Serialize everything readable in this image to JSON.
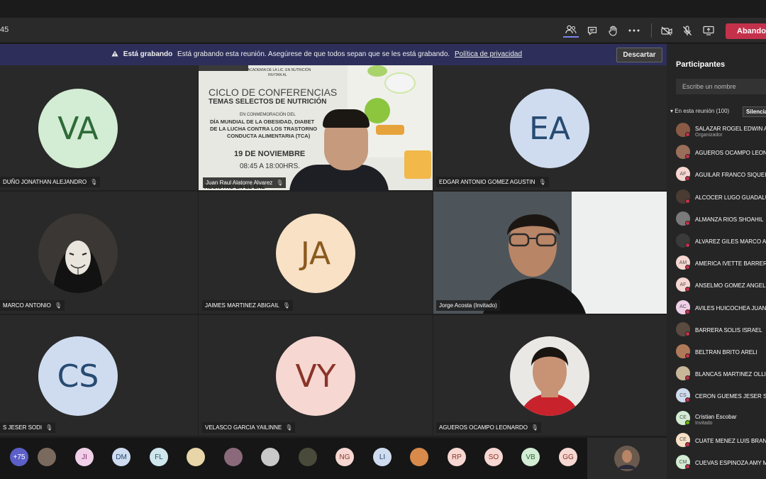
{
  "meeting": {
    "timer": "45"
  },
  "toolbar": {
    "participants_icon": "people-icon",
    "chat_icon": "chat-icon",
    "hand_icon": "raise-hand-icon",
    "more_icon": "more-icon",
    "camera_icon": "camera-off-icon",
    "mic_icon": "mic-off-icon",
    "share_icon": "share-screen-icon",
    "leave_label": "Abandonar"
  },
  "banner": {
    "bold": "Está grabando",
    "text": "Está grabando esta reunión. Asegúrese de que todos sepan que se les está grabando.",
    "link": "Política de privacidad",
    "dismiss_label": "Descartar"
  },
  "tiles": [
    {
      "name": "DUÑO JONATHAN ALEJANDRO",
      "initials": "VA",
      "bg": "#d3ecd4",
      "fg": "#2e6b37"
    },
    {
      "name": "Juan Raul Alatorre Alvarez",
      "initials": "",
      "bg": "",
      "fg": ""
    },
    {
      "name": "EDGAR ANTONIO GOMEZ AGUSTIN",
      "initials": "EA",
      "bg": "#cfdcef",
      "fg": "#274a72"
    },
    {
      "name": "MARCO ANTONIO",
      "initials": "",
      "bg": "",
      "fg": ""
    },
    {
      "name": "JAIMES MARTINEZ ABIGAIL",
      "initials": "JA",
      "bg": "#f8e1c5",
      "fg": "#8a5a1e"
    },
    {
      "name": "Jorge Acosta (Invitado)",
      "initials": "",
      "bg": "",
      "fg": ""
    },
    {
      "name": "S JESER SODI",
      "initials": "CS",
      "bg": "#cfdcef",
      "fg": "#274a72"
    },
    {
      "name": "VELASCO GARCIA YAILINNE",
      "initials": "VY",
      "bg": "#f6d7d2",
      "fg": "#8a3428"
    },
    {
      "name": "AGUEROS OCAMPO LEONARDO",
      "initials": "",
      "bg": "",
      "fg": ""
    }
  ],
  "slide": {
    "line1": "LA ACADEMIA DE LA LIC. EN NUTRICIÓN",
    "line1b": "INVITAN AL",
    "title1": "CICLO DE CONFERENCIAS",
    "title2": "TEMAS SELECTOS DE NUTRICIÓN",
    "sub1": "EN CONMEMORACIÓN DEL",
    "sub2": "DÍA MUNDIAL DE LA OBESIDAD, DIABET",
    "sub3": "DE LA LUCHA CONTRA LOS TRASTORNO",
    "sub4": "CONDUCTA ALIMENTARIA (TCA)",
    "date": "19 DE NOVIEMBRE",
    "time": "08:45 A 18:00HRS.",
    "footer": "REGISTRO EN EL ENL"
  },
  "panel": {
    "title": "Participantes",
    "search_placeholder": "Escribe un nombre",
    "section": "En esta reunión (100)",
    "mute_all": "Silenciar",
    "people": [
      {
        "name": "SALAZAR ROGEL EDWIN A",
        "sub": "Organizador",
        "initials": "",
        "color": "#8a5a44",
        "status": "red"
      },
      {
        "name": "AGUEROS OCAMPO LEON",
        "sub": "",
        "initials": "",
        "color": "#9a6f5a",
        "status": "red"
      },
      {
        "name": "AGUILAR FRANCO SIQUEI",
        "sub": "",
        "initials": "AF",
        "color": "#f6d7d2",
        "status": "red"
      },
      {
        "name": "ALCOCER LUGO GUADALU",
        "sub": "",
        "initials": "",
        "color": "#4a3b33",
        "status": "red"
      },
      {
        "name": "ALMANZA RIOS SHOAHIL",
        "sub": "",
        "initials": "",
        "color": "#7a7a7a",
        "status": "red"
      },
      {
        "name": "ALVAREZ GILES MARCO A",
        "sub": "",
        "initials": "",
        "color": "#3a3a3a",
        "status": "red"
      },
      {
        "name": "AMERICA IVETTE BARRERA",
        "sub": "",
        "initials": "AM",
        "color": "#f6d7d2",
        "status": "red"
      },
      {
        "name": "ANSELMO GOMEZ ANGEL",
        "sub": "",
        "initials": "AF",
        "color": "#f6d7d2",
        "status": "red"
      },
      {
        "name": "AVILES HUICOCHEA JUAN",
        "sub": "",
        "initials": "AC",
        "color": "#f0d0e8",
        "status": "red"
      },
      {
        "name": "BARRERA SOLIS ISRAEL",
        "sub": "",
        "initials": "",
        "color": "#5a4a40",
        "status": "red"
      },
      {
        "name": "BELTRAN BRITO ARELI",
        "sub": "",
        "initials": "",
        "color": "#b07a5a",
        "status": "red"
      },
      {
        "name": "BLANCAS MARTINEZ OLLI",
        "sub": "",
        "initials": "",
        "color": "#c9b79a",
        "status": "red"
      },
      {
        "name": "CERON GUEMES JESER SO",
        "sub": "",
        "initials": "CS",
        "color": "#cfdcef",
        "status": "red"
      },
      {
        "name": "Cristian Escobar",
        "sub": "Invitado",
        "initials": "CE",
        "color": "#d3ecd4",
        "status": "green"
      },
      {
        "name": "CUATE MENEZ LUIS BRAN",
        "sub": "",
        "initials": "CE",
        "color": "#f8e1c5",
        "status": "red"
      },
      {
        "name": "CUEVAS ESPINOZA AMY M",
        "sub": "",
        "initials": "CM",
        "color": "#d3ecd4",
        "status": "red"
      }
    ]
  },
  "strip": [
    {
      "label": "+75",
      "color": "#5b5fc7",
      "fg": "#ffffff"
    },
    {
      "label": "",
      "color": "#7a6a5e",
      "fg": "#ffffff"
    },
    {
      "label": "JI",
      "color": "#f0d0e8",
      "fg": "#8a2e6e"
    },
    {
      "label": "DM",
      "color": "#cfdcef",
      "fg": "#274a72"
    },
    {
      "label": "FL",
      "color": "#cfe6ec",
      "fg": "#245a66"
    },
    {
      "label": "",
      "color": "#e8d6a8",
      "fg": "#ffffff"
    },
    {
      "label": "",
      "color": "#8a6a7a",
      "fg": "#ffffff"
    },
    {
      "label": "",
      "color": "#c9c9c9",
      "fg": "#ffffff"
    },
    {
      "label": "",
      "color": "#4a4a3a",
      "fg": "#ffffff"
    },
    {
      "label": "NG",
      "color": "#f6d7d2",
      "fg": "#8a3428"
    },
    {
      "label": "LI",
      "color": "#cfdcef",
      "fg": "#274a72"
    },
    {
      "label": "",
      "color": "#d88a4a",
      "fg": "#ffffff"
    },
    {
      "label": "RP",
      "color": "#f6d7d2",
      "fg": "#8a3428"
    },
    {
      "label": "SO",
      "color": "#f6d7d2",
      "fg": "#8a3428"
    },
    {
      "label": "VB",
      "color": "#d3ecd4",
      "fg": "#2e6b37"
    },
    {
      "label": "GG",
      "color": "#f6d7d2",
      "fg": "#8a3428"
    }
  ]
}
